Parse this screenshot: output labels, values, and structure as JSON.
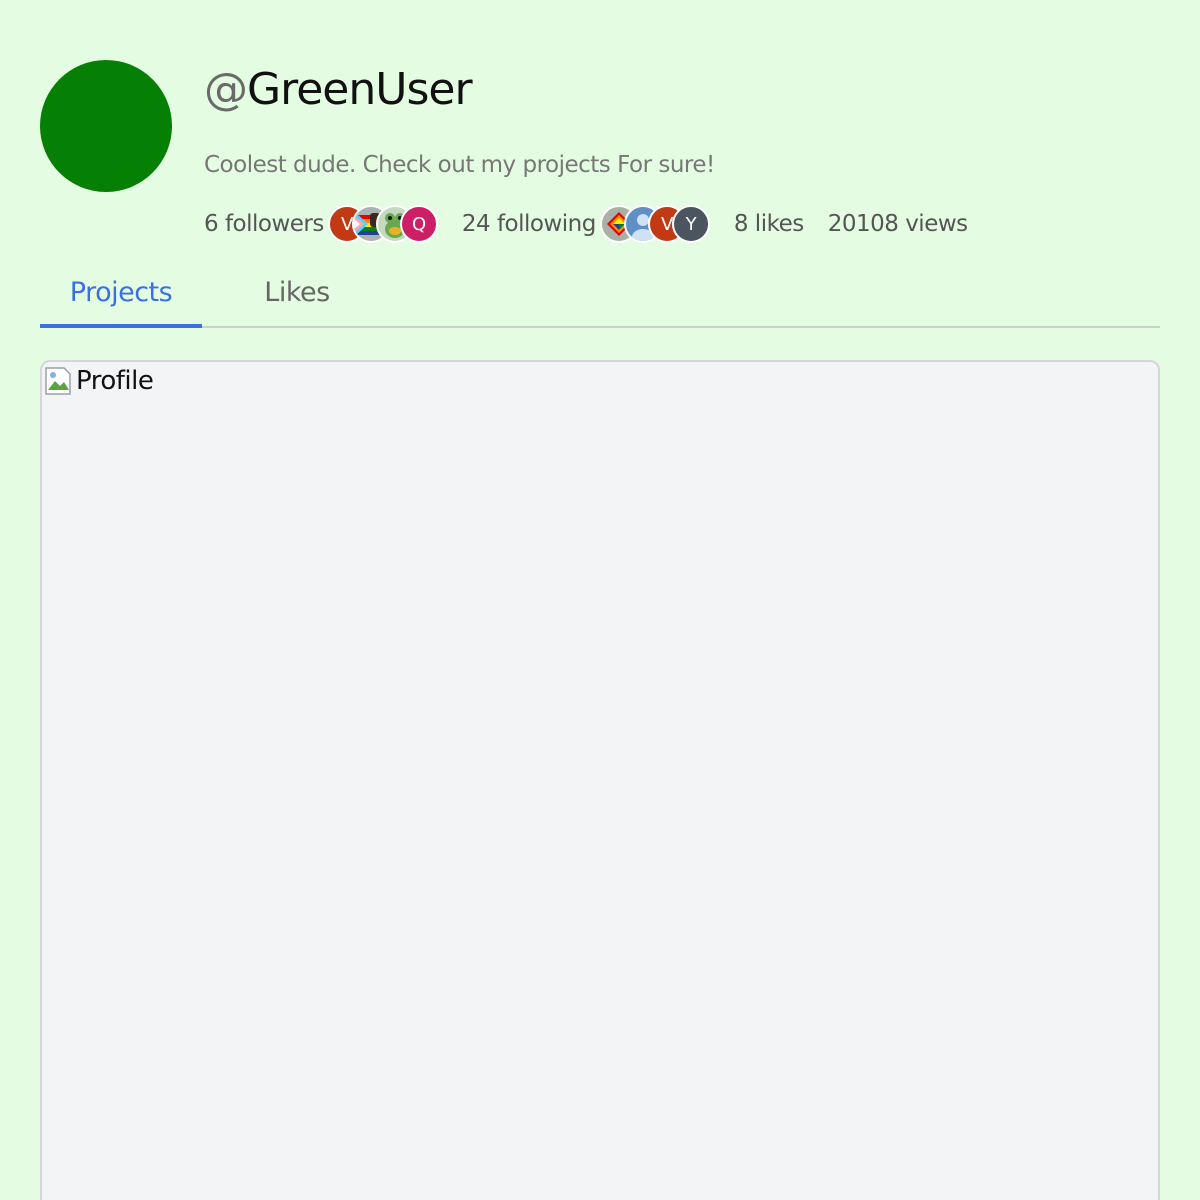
{
  "profile": {
    "at_sign": "@",
    "username": "GreenUser",
    "bio": "Coolest dude. Check out my projects For sure!",
    "avatar_color": "#058004"
  },
  "stats": {
    "followers_label": "6 followers",
    "following_label": "24 following",
    "likes_label": "8 likes",
    "views_label": "20108 views",
    "follower_avatars": [
      {
        "letter": "V",
        "color": "#c23a14"
      },
      {
        "icon": "pride-flag-fist-icon",
        "color": "#aab2b4"
      },
      {
        "icon": "frog-emoji-icon",
        "color": "#c5d9c0"
      },
      {
        "letter": "Q",
        "color": "#cc1f66"
      }
    ],
    "following_avatars": [
      {
        "icon": "rainbow-diamond-icon",
        "color": "#a8b0a8"
      },
      {
        "icon": "user-silhouette-icon",
        "color": "#5f8fc4"
      },
      {
        "letter": "V",
        "color": "#c23a14"
      },
      {
        "letter": "Y",
        "color": "#4a5560"
      }
    ]
  },
  "tabs": {
    "projects_label": "Projects",
    "likes_label": "Likes",
    "active": "Projects",
    "active_color": "#3b70e0"
  },
  "content": {
    "image_alt": "Profile"
  }
}
